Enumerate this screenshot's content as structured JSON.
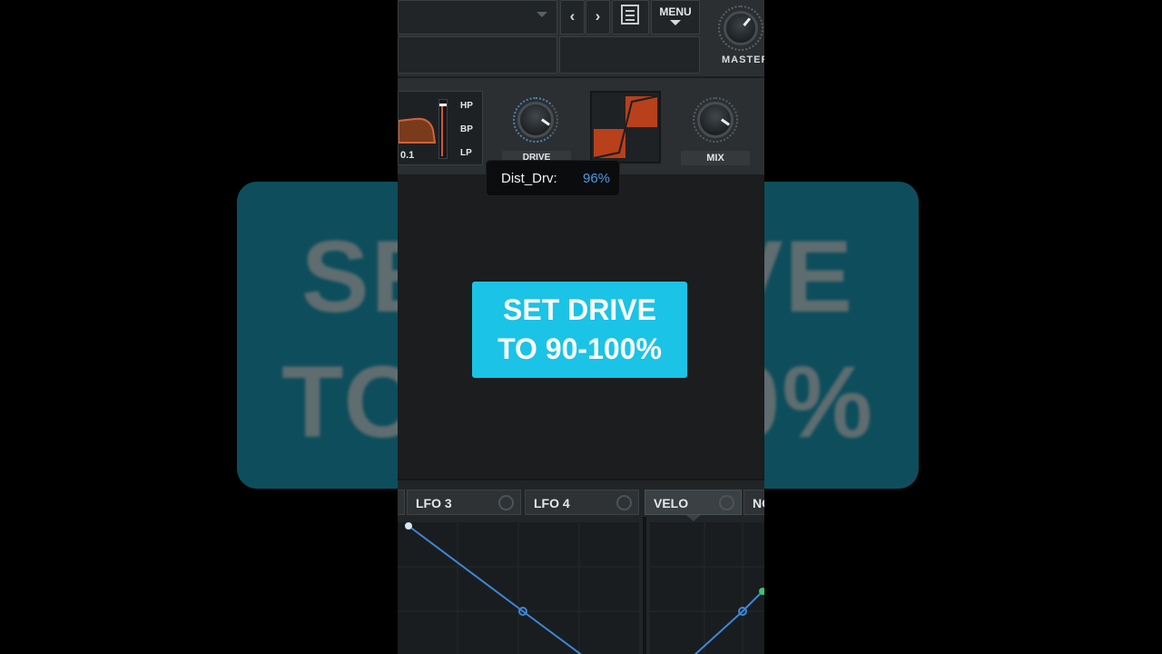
{
  "background_caption": {
    "line1": "SET DRIVE",
    "line2": "TO 90-100%"
  },
  "toolbar": {
    "prev_symbol": "‹",
    "next_symbol": "›",
    "menu_label": "MENU",
    "master_label": "MASTER"
  },
  "filter": {
    "value": "0.1",
    "types": [
      "HP",
      "BP",
      "LP"
    ]
  },
  "fx": {
    "drive_label": "DRIVE",
    "mix_label": "MIX"
  },
  "tooltip": {
    "key": "Dist_Drv:",
    "value": "96%"
  },
  "caption": {
    "line1": "SET DRIVE",
    "line2": "TO 90-100%"
  },
  "mod_tabs": [
    {
      "label": "LFO 3"
    },
    {
      "label": "LFO 4"
    },
    {
      "label": "VELO"
    },
    {
      "label": "NO"
    }
  ],
  "colors": {
    "caption_bg": "#1bc3e6",
    "accent_orange": "#c8451c",
    "tooltip_value": "#4f9be6",
    "envelope_line": "#3f86d6"
  }
}
